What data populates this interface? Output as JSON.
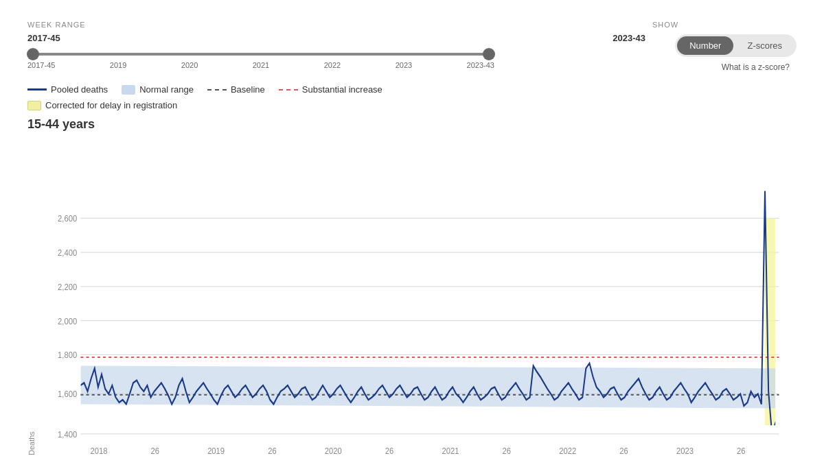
{
  "header": {
    "range_label": "WEEK RANGE",
    "show_label": "SHOW",
    "range_start": "2017-45",
    "range_end": "2023-43",
    "slider_ticks": [
      "2017-45",
      "2019",
      "2020",
      "2021",
      "2022",
      "2023",
      "2023-43"
    ],
    "toggle_number": "Number",
    "toggle_zscores": "Z-scores",
    "zscore_link": "What is a z-score?"
  },
  "legend": {
    "pooled_deaths": "Pooled deaths",
    "normal_range": "Normal range",
    "baseline": "Baseline",
    "substantial_increase": "Substantial increase",
    "corrected": "Corrected for delay in registration"
  },
  "chart": {
    "title": "15-44 years",
    "y_label": "Deaths",
    "y_ticks": [
      "2,600",
      "2,400",
      "2,200",
      "2,000",
      "1,800",
      "1,600",
      "1,400"
    ],
    "x_ticks": [
      "2018",
      "26",
      "2019",
      "26",
      "2020",
      "26",
      "2021",
      "26",
      "2022",
      "26",
      "2023",
      "26"
    ]
  }
}
